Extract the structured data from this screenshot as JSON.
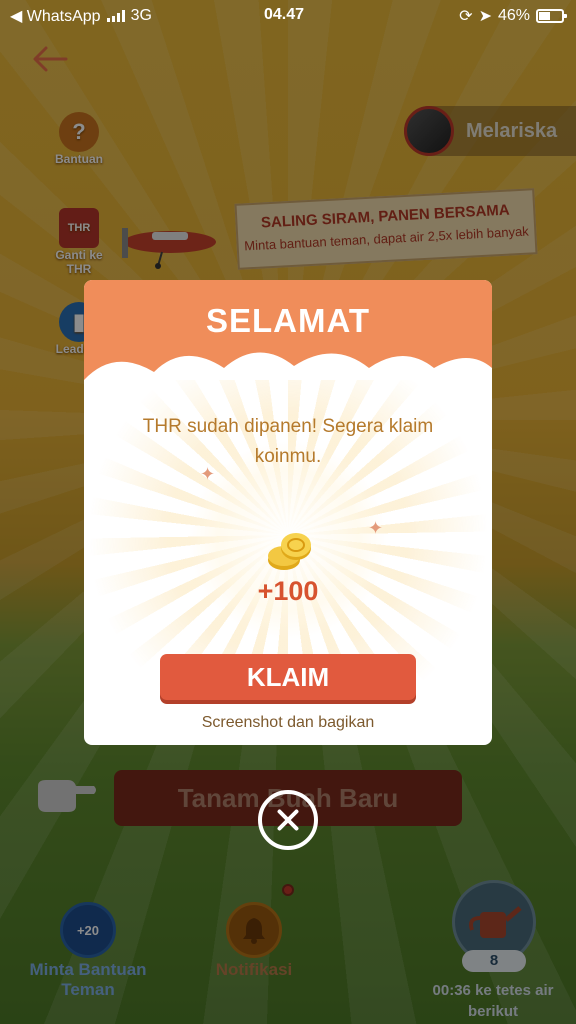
{
  "status_bar": {
    "back_app": "◀ WhatsApp",
    "network": "3G",
    "time": "04.47",
    "battery": "46%"
  },
  "game": {
    "side_buttons": [
      {
        "label": "Bantuan",
        "icon": "help-icon"
      },
      {
        "label": "Ganti ke THR",
        "icon": "thr-icon",
        "badge": "THR"
      },
      {
        "label": "Leaderb",
        "icon": "leaderboard-icon"
      }
    ],
    "user_name": "Melariska",
    "banner_title": "SALING SIRAM, PANEN BERSAMA",
    "banner_subtitle": "Minta bantuan teman, dapat air 2,5x lebih banyak",
    "plant_button": "Tanam Buah Baru",
    "bottom": {
      "help_badge": "+20",
      "help_label": "Minta Bantuan Teman",
      "notif_label": "Notifikasi",
      "water_count": "8",
      "water_timer": "00:36 ke tetes air berikut"
    }
  },
  "modal": {
    "title": "SELAMAT",
    "message": "THR sudah dipanen! Segera klaim koinmu.",
    "reward": "+100",
    "claim_button": "KLAIM",
    "share_text": "Screenshot dan bagikan"
  },
  "colors": {
    "header": "#f08d5a",
    "claim": "#e15a3e",
    "message_text": "#b57a2c",
    "reward_text": "#d7532f"
  }
}
